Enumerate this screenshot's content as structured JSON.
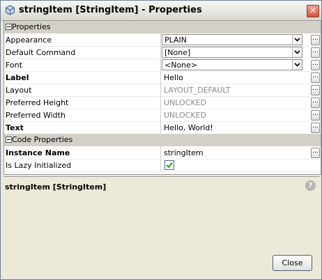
{
  "window": {
    "title": "stringItem [StringItem] - Properties"
  },
  "categories": {
    "properties": "Properties",
    "code_properties": "Code Properties"
  },
  "properties": [
    {
      "name": "Appearance",
      "value": "PLAIN",
      "bold": false,
      "editor": "combo"
    },
    {
      "name": "Default Command",
      "value": "[None]",
      "bold": false,
      "editor": "combo"
    },
    {
      "name": "Font",
      "value": "<None>",
      "bold": false,
      "editor": "combo"
    },
    {
      "name": "Label",
      "value": "Hello",
      "bold": true,
      "editor": "text"
    },
    {
      "name": "Layout",
      "value": "LAYOUT_DEFAULT",
      "bold": false,
      "editor": "text-gray"
    },
    {
      "name": "Preferred Height",
      "value": "UNLOCKED",
      "bold": false,
      "editor": "text-gray"
    },
    {
      "name": "Preferred Width",
      "value": "UNLOCKED",
      "bold": false,
      "editor": "text-gray"
    },
    {
      "name": "Text",
      "value": "Hello, World!",
      "bold": true,
      "editor": "text"
    }
  ],
  "code_properties": [
    {
      "name": "Instance Name",
      "value": "stringItem",
      "bold": true,
      "editor": "text"
    },
    {
      "name": "Is Lazy Initialized",
      "value": true,
      "bold": false,
      "editor": "checkbox"
    }
  ],
  "ellipsis_label": "...",
  "description": {
    "title": "stringItem [StringItem]"
  },
  "buttons": {
    "close": "Close"
  },
  "colors": {
    "titlebar": "#e6e5df",
    "panel": "#ece9d8",
    "category": "#d4d0c8",
    "close_x": "#d6553e"
  }
}
